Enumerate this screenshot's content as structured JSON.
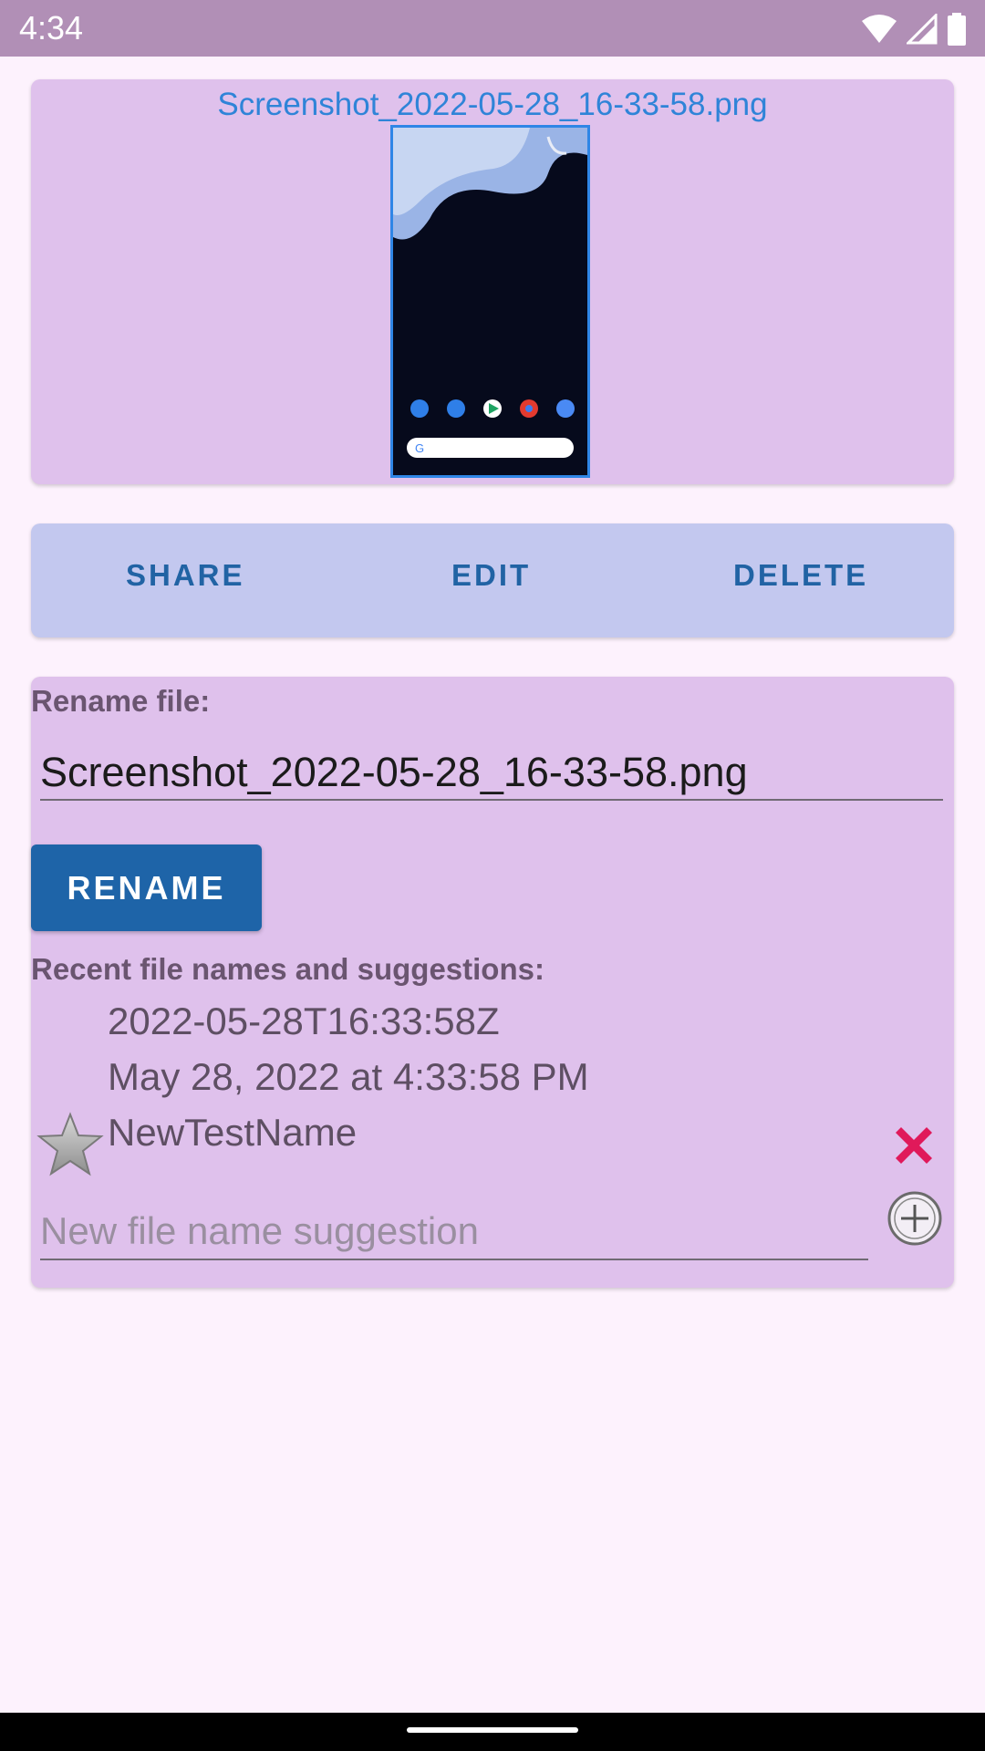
{
  "status_bar": {
    "time": "4:34"
  },
  "preview": {
    "file_name": "Screenshot_2022-05-28_16-33-58.png"
  },
  "actions": {
    "share": "SHARE",
    "edit": "EDIT",
    "delete": "DELETE"
  },
  "rename": {
    "label": "Rename file:",
    "value": "Screenshot_2022-05-28_16-33-58.png",
    "button": "RENAME"
  },
  "suggestions": {
    "label": "Recent file names and suggestions:",
    "items": [
      {
        "text": "2022-05-28T16:33:58Z"
      },
      {
        "text": "May 28, 2022 at 4:33:58 PM"
      },
      {
        "text": "NewTestName"
      }
    ],
    "new_placeholder": "New file name suggestion"
  },
  "colors": {
    "accent": "#1e64a8",
    "link": "#2f84d8",
    "delete_icon": "#e0195a",
    "card": "#dfc1ec",
    "action_card": "#c3c8ef"
  },
  "icons": {
    "wifi": "wifi-icon",
    "signal": "signal-icon",
    "battery": "battery-icon",
    "star": "star-icon",
    "delete": "close-icon",
    "add": "add-circle-icon"
  }
}
